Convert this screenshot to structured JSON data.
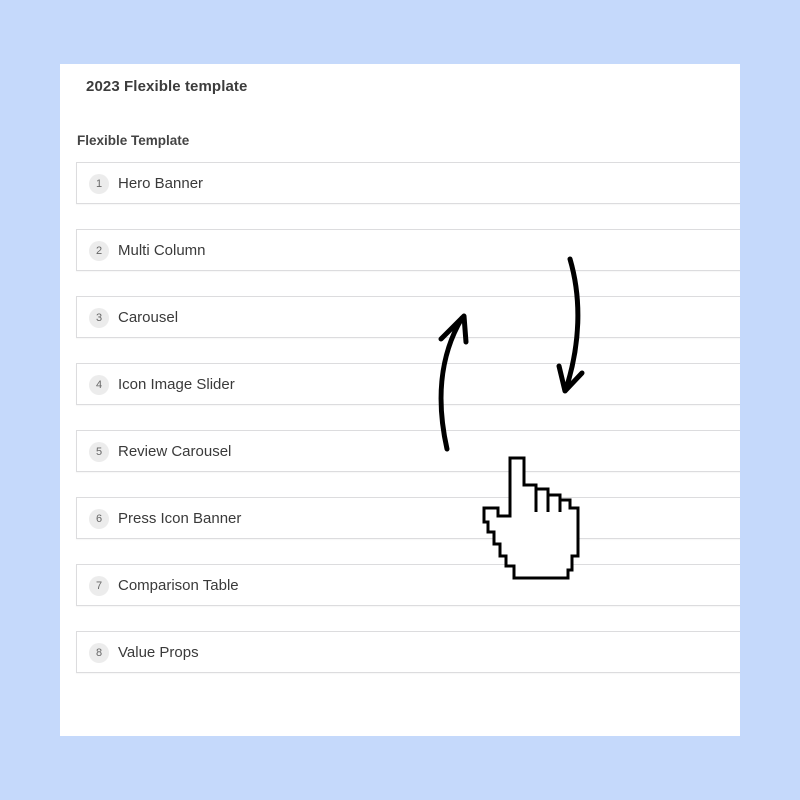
{
  "panel": {
    "title": "2023 Flexible template",
    "field_label": "Flexible Template"
  },
  "layouts": [
    {
      "index": "1",
      "label": "Hero Banner"
    },
    {
      "index": "2",
      "label": "Multi Column"
    },
    {
      "index": "3",
      "label": "Carousel"
    },
    {
      "index": "4",
      "label": "Icon Image Slider"
    },
    {
      "index": "5",
      "label": "Review Carousel"
    },
    {
      "index": "6",
      "label": "Press Icon Banner"
    },
    {
      "index": "7",
      "label": "Comparison Table"
    },
    {
      "index": "8",
      "label": "Value Props"
    }
  ],
  "overlay": {
    "icons": [
      "arrow-up-icon",
      "arrow-down-icon",
      "hand-pointer-cursor-icon"
    ]
  },
  "colors": {
    "background": "#c5d9fb",
    "panel": "#ffffff",
    "row_border": "#dcdcde",
    "handle_bg": "#ececec"
  }
}
